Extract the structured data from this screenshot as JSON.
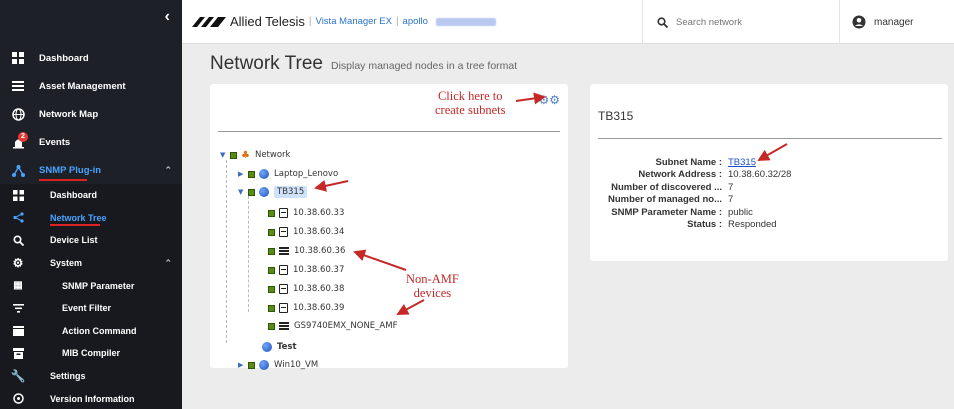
{
  "sidebar": {
    "collapse_icon": "chevron-left-icon",
    "items": [
      {
        "label": "Dashboard",
        "icon": "dashboard-icon"
      },
      {
        "label": "Asset Management",
        "icon": "list-icon"
      },
      {
        "label": "Network Map",
        "icon": "globe-icon"
      },
      {
        "label": "Events",
        "icon": "alarm-icon",
        "badge": "2"
      },
      {
        "label": "SNMP Plug-in",
        "icon": "snmp-icon"
      },
      {
        "label": "Dashboard",
        "icon": "dashboard-icon"
      },
      {
        "label": "Network Tree",
        "icon": "share-icon"
      },
      {
        "label": "Device List",
        "icon": "search-icon"
      },
      {
        "label": "System",
        "icon": "gear-icon"
      },
      {
        "label": "SNMP Parameter",
        "icon": "grid-icon"
      },
      {
        "label": "Event Filter",
        "icon": "filter-icon"
      },
      {
        "label": "Action Command",
        "icon": "clapper-icon"
      },
      {
        "label": "MIB Compiler",
        "icon": "box-icon"
      },
      {
        "label": "Settings",
        "icon": "wrench-icon"
      },
      {
        "label": "Version Information",
        "icon": "info-icon"
      }
    ]
  },
  "topbar": {
    "brand": "Allied Telesis",
    "product": "Vista Manager EX",
    "host": "apollo",
    "search_placeholder": "Search network",
    "user": "manager"
  },
  "page": {
    "title": "Network Tree",
    "subtitle": "Display managed nodes in a tree format"
  },
  "tree": {
    "root": "Network",
    "nodes": [
      {
        "label": "Laptop_Lenovo"
      },
      {
        "label": "TB315"
      },
      {
        "label": "10.38.60.33"
      },
      {
        "label": "10.38.60.34"
      },
      {
        "label": "10.38.60.36"
      },
      {
        "label": "10.38.60.37"
      },
      {
        "label": "10.38.60.38"
      },
      {
        "label": "10.38.60.39"
      },
      {
        "label": "GS9740EMX_NONE_AMF"
      },
      {
        "label": "Test"
      },
      {
        "label": "Win10_VM"
      }
    ]
  },
  "annotations": {
    "create_subnets_1": "Click here to",
    "create_subnets_2": "create subnets",
    "non_amf_1": "Non-AMF",
    "non_amf_2": "devices",
    "color": "#c62828"
  },
  "details": {
    "title": "TB315",
    "rows": [
      {
        "key": "Subnet Name :",
        "value": "TB315"
      },
      {
        "key": "Network Address :",
        "value": "10.38.60.32/28"
      },
      {
        "key": "Number of discovered ...",
        "value": "7"
      },
      {
        "key": "Number of managed no...",
        "value": "7"
      },
      {
        "key": "SNMP Parameter Name :",
        "value": "public"
      },
      {
        "key": "Status :",
        "value": "Responded"
      }
    ]
  },
  "colors": {
    "sidebar_bg": "#1d2026",
    "accent": "#4aa3ff",
    "link": "#1a4fc9",
    "annotation": "#c62828"
  }
}
